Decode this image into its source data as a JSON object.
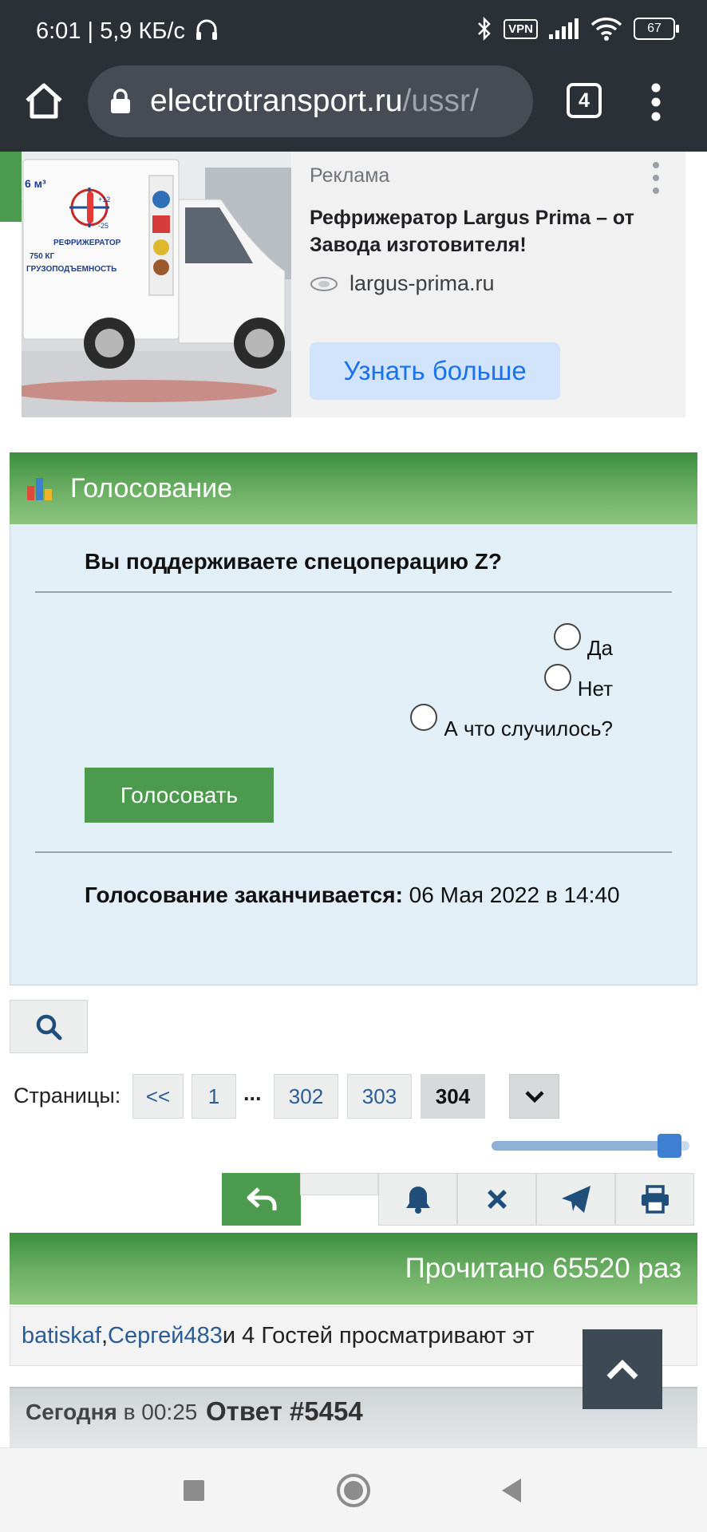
{
  "status_bar": {
    "time_speed": "6:01 | 5,9 КБ/с",
    "vpn": "VPN",
    "battery": "67",
    "icons": [
      "headphones-icon",
      "bluetooth-icon",
      "vpn-icon",
      "signal-icon",
      "wifi-icon",
      "battery-icon"
    ]
  },
  "browser": {
    "url_host": "electrotransport.ru",
    "url_path": "/ussr/",
    "tab_count": "4"
  },
  "ad": {
    "label": "Реклама",
    "title": "Рефрижератор Largus Prima – от Завода изготовителя!",
    "domain": "largus-prima.ru",
    "cta": "Узнать больше",
    "image_text": {
      "volume": "6 м³",
      "temp_high": "+12",
      "temp_low": "-25",
      "kind": "РЕФРИЖЕРАТОР",
      "load": "750 КГ",
      "load_label": "ГРУЗОПОДЪЕМНОСТЬ"
    }
  },
  "poll": {
    "header": "Голосование",
    "question": "Вы поддерживаете спецоперацию Z?",
    "options": [
      "Да",
      "Нет",
      "А что случилось?"
    ],
    "vote_button": "Голосовать",
    "ends_label": "Голосование заканчивается:",
    "ends_value": "06 Мая 2022 в 14:40"
  },
  "pagination": {
    "label": "Страницы:",
    "first": "<<",
    "pages": [
      "1",
      "302",
      "303",
      "304"
    ],
    "ellipsis": "...",
    "current": "304",
    "slider_position": 0.9
  },
  "actions": [
    "reply-icon",
    "bell-icon",
    "close-icon",
    "send-icon",
    "print-icon"
  ],
  "thread": {
    "read_count": "Прочитано 65520 раз",
    "viewers": {
      "user1": "batiskaf",
      "sep": ", ",
      "user2": "Сергей483",
      "rest": " и 4 Гостей просматривают эт"
    },
    "post_date_day": "Сегодня",
    "post_date_rest": " в 00:25",
    "post_number": "Ответ #5454"
  },
  "colors": {
    "forum_green": "#4c9a4e",
    "poll_bg": "#e2eff7",
    "link_blue": "#2b5c93",
    "browser_dark": "#2b2f36",
    "ad_cta_bg": "#d2e3fc"
  }
}
